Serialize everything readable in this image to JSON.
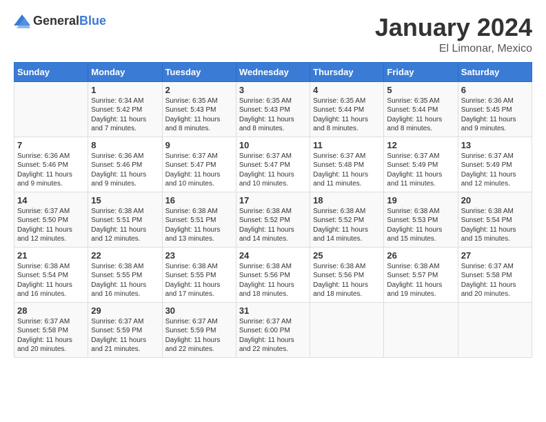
{
  "header": {
    "logo_general": "General",
    "logo_blue": "Blue",
    "month": "January 2024",
    "location": "El Limonar, Mexico"
  },
  "calendar": {
    "days_of_week": [
      "Sunday",
      "Monday",
      "Tuesday",
      "Wednesday",
      "Thursday",
      "Friday",
      "Saturday"
    ],
    "weeks": [
      [
        {
          "day": "",
          "sunrise": "",
          "sunset": "",
          "daylight": ""
        },
        {
          "day": "1",
          "sunrise": "Sunrise: 6:34 AM",
          "sunset": "Sunset: 5:42 PM",
          "daylight": "Daylight: 11 hours and 7 minutes."
        },
        {
          "day": "2",
          "sunrise": "Sunrise: 6:35 AM",
          "sunset": "Sunset: 5:43 PM",
          "daylight": "Daylight: 11 hours and 8 minutes."
        },
        {
          "day": "3",
          "sunrise": "Sunrise: 6:35 AM",
          "sunset": "Sunset: 5:43 PM",
          "daylight": "Daylight: 11 hours and 8 minutes."
        },
        {
          "day": "4",
          "sunrise": "Sunrise: 6:35 AM",
          "sunset": "Sunset: 5:44 PM",
          "daylight": "Daylight: 11 hours and 8 minutes."
        },
        {
          "day": "5",
          "sunrise": "Sunrise: 6:35 AM",
          "sunset": "Sunset: 5:44 PM",
          "daylight": "Daylight: 11 hours and 8 minutes."
        },
        {
          "day": "6",
          "sunrise": "Sunrise: 6:36 AM",
          "sunset": "Sunset: 5:45 PM",
          "daylight": "Daylight: 11 hours and 9 minutes."
        }
      ],
      [
        {
          "day": "7",
          "sunrise": "Sunrise: 6:36 AM",
          "sunset": "Sunset: 5:46 PM",
          "daylight": "Daylight: 11 hours and 9 minutes."
        },
        {
          "day": "8",
          "sunrise": "Sunrise: 6:36 AM",
          "sunset": "Sunset: 5:46 PM",
          "daylight": "Daylight: 11 hours and 9 minutes."
        },
        {
          "day": "9",
          "sunrise": "Sunrise: 6:37 AM",
          "sunset": "Sunset: 5:47 PM",
          "daylight": "Daylight: 11 hours and 10 minutes."
        },
        {
          "day": "10",
          "sunrise": "Sunrise: 6:37 AM",
          "sunset": "Sunset: 5:47 PM",
          "daylight": "Daylight: 11 hours and 10 minutes."
        },
        {
          "day": "11",
          "sunrise": "Sunrise: 6:37 AM",
          "sunset": "Sunset: 5:48 PM",
          "daylight": "Daylight: 11 hours and 11 minutes."
        },
        {
          "day": "12",
          "sunrise": "Sunrise: 6:37 AM",
          "sunset": "Sunset: 5:49 PM",
          "daylight": "Daylight: 11 hours and 11 minutes."
        },
        {
          "day": "13",
          "sunrise": "Sunrise: 6:37 AM",
          "sunset": "Sunset: 5:49 PM",
          "daylight": "Daylight: 11 hours and 12 minutes."
        }
      ],
      [
        {
          "day": "14",
          "sunrise": "Sunrise: 6:37 AM",
          "sunset": "Sunset: 5:50 PM",
          "daylight": "Daylight: 11 hours and 12 minutes."
        },
        {
          "day": "15",
          "sunrise": "Sunrise: 6:38 AM",
          "sunset": "Sunset: 5:51 PM",
          "daylight": "Daylight: 11 hours and 12 minutes."
        },
        {
          "day": "16",
          "sunrise": "Sunrise: 6:38 AM",
          "sunset": "Sunset: 5:51 PM",
          "daylight": "Daylight: 11 hours and 13 minutes."
        },
        {
          "day": "17",
          "sunrise": "Sunrise: 6:38 AM",
          "sunset": "Sunset: 5:52 PM",
          "daylight": "Daylight: 11 hours and 14 minutes."
        },
        {
          "day": "18",
          "sunrise": "Sunrise: 6:38 AM",
          "sunset": "Sunset: 5:52 PM",
          "daylight": "Daylight: 11 hours and 14 minutes."
        },
        {
          "day": "19",
          "sunrise": "Sunrise: 6:38 AM",
          "sunset": "Sunset: 5:53 PM",
          "daylight": "Daylight: 11 hours and 15 minutes."
        },
        {
          "day": "20",
          "sunrise": "Sunrise: 6:38 AM",
          "sunset": "Sunset: 5:54 PM",
          "daylight": "Daylight: 11 hours and 15 minutes."
        }
      ],
      [
        {
          "day": "21",
          "sunrise": "Sunrise: 6:38 AM",
          "sunset": "Sunset: 5:54 PM",
          "daylight": "Daylight: 11 hours and 16 minutes."
        },
        {
          "day": "22",
          "sunrise": "Sunrise: 6:38 AM",
          "sunset": "Sunset: 5:55 PM",
          "daylight": "Daylight: 11 hours and 16 minutes."
        },
        {
          "day": "23",
          "sunrise": "Sunrise: 6:38 AM",
          "sunset": "Sunset: 5:55 PM",
          "daylight": "Daylight: 11 hours and 17 minutes."
        },
        {
          "day": "24",
          "sunrise": "Sunrise: 6:38 AM",
          "sunset": "Sunset: 5:56 PM",
          "daylight": "Daylight: 11 hours and 18 minutes."
        },
        {
          "day": "25",
          "sunrise": "Sunrise: 6:38 AM",
          "sunset": "Sunset: 5:56 PM",
          "daylight": "Daylight: 11 hours and 18 minutes."
        },
        {
          "day": "26",
          "sunrise": "Sunrise: 6:38 AM",
          "sunset": "Sunset: 5:57 PM",
          "daylight": "Daylight: 11 hours and 19 minutes."
        },
        {
          "day": "27",
          "sunrise": "Sunrise: 6:37 AM",
          "sunset": "Sunset: 5:58 PM",
          "daylight": "Daylight: 11 hours and 20 minutes."
        }
      ],
      [
        {
          "day": "28",
          "sunrise": "Sunrise: 6:37 AM",
          "sunset": "Sunset: 5:58 PM",
          "daylight": "Daylight: 11 hours and 20 minutes."
        },
        {
          "day": "29",
          "sunrise": "Sunrise: 6:37 AM",
          "sunset": "Sunset: 5:59 PM",
          "daylight": "Daylight: 11 hours and 21 minutes."
        },
        {
          "day": "30",
          "sunrise": "Sunrise: 6:37 AM",
          "sunset": "Sunset: 5:59 PM",
          "daylight": "Daylight: 11 hours and 22 minutes."
        },
        {
          "day": "31",
          "sunrise": "Sunrise: 6:37 AM",
          "sunset": "Sunset: 6:00 PM",
          "daylight": "Daylight: 11 hours and 22 minutes."
        },
        {
          "day": "",
          "sunrise": "",
          "sunset": "",
          "daylight": ""
        },
        {
          "day": "",
          "sunrise": "",
          "sunset": "",
          "daylight": ""
        },
        {
          "day": "",
          "sunrise": "",
          "sunset": "",
          "daylight": ""
        }
      ]
    ]
  }
}
